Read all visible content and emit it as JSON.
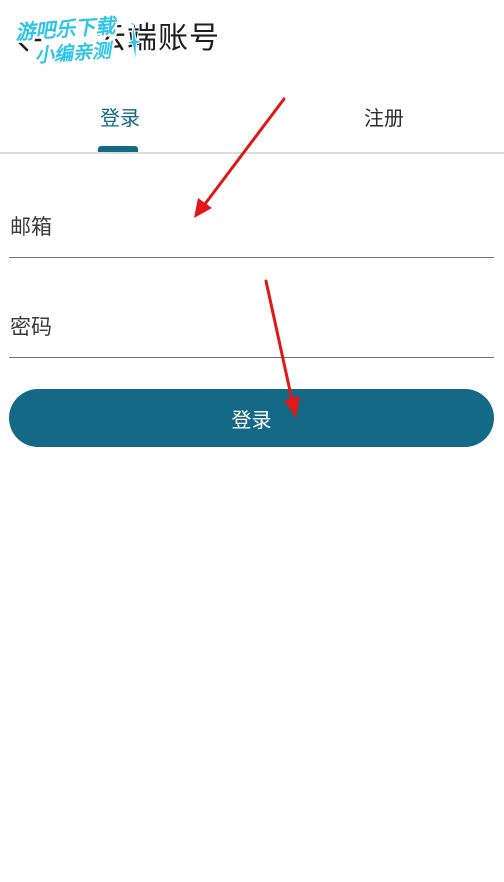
{
  "header": {
    "title": "云端账号",
    "watermark_line1": "游吧乐下载",
    "watermark_line2": "小编亲测"
  },
  "tabs": [
    {
      "label": "登录",
      "active": true
    },
    {
      "label": "注册",
      "active": false
    }
  ],
  "form": {
    "email_placeholder": "邮箱",
    "password_placeholder": "密码",
    "submit_label": "登录"
  },
  "colors": {
    "accent": "#136986",
    "annotation_arrow": "#e01818",
    "watermark": "#2fc4ea"
  },
  "icons": {
    "back": "arrow-left-icon"
  }
}
